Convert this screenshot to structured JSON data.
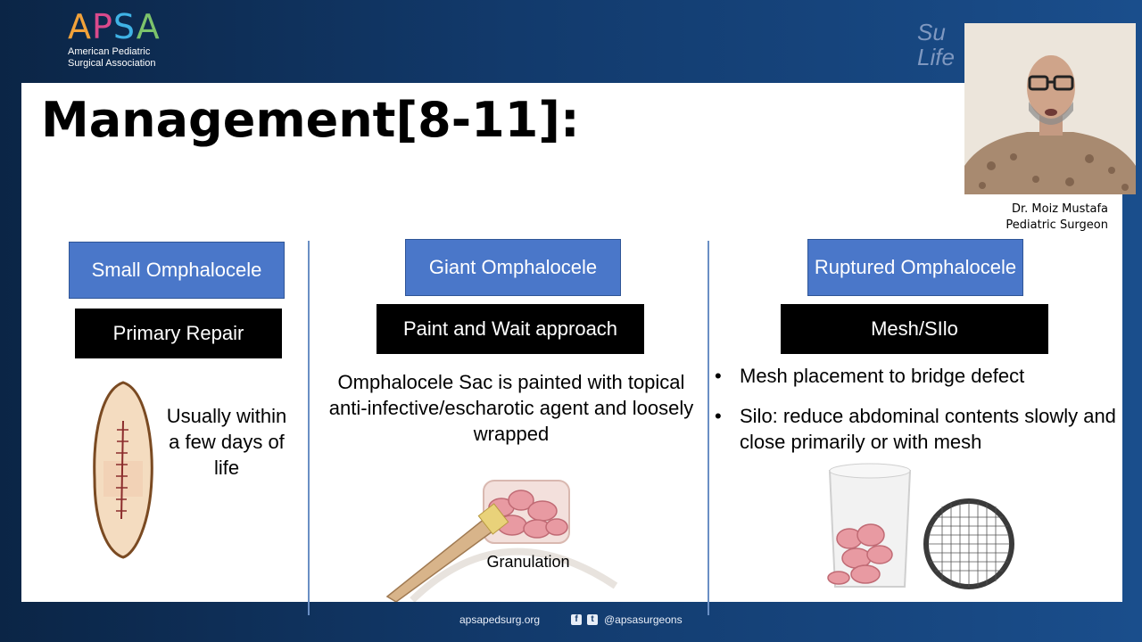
{
  "logo": {
    "letters": [
      "A",
      "P",
      "S",
      "A"
    ],
    "line1": "American Pediatric",
    "line2": "Surgical Association"
  },
  "corner_title": "Su   c\nLife",
  "slide": {
    "title": "Management[8-11]:",
    "columns": [
      {
        "header": "Small Omphalocele",
        "action": "Primary Repair",
        "note": "Usually within a few days of life"
      },
      {
        "header": "Giant Omphalocele",
        "action": "Paint and Wait approach",
        "note": "Omphalocele Sac is painted with topical anti-infective/escharotic agent and loosely wrapped",
        "figure_label": "Granulation"
      },
      {
        "header": "Ruptured Omphalocele",
        "action": "Mesh/SIlo",
        "bullets": [
          "Mesh placement to bridge defect",
          "Silo: reduce abdominal contents slowly and close primarily or with mesh"
        ]
      }
    ]
  },
  "speaker": {
    "name": "Dr. Moiz Mustafa",
    "role": "Pediatric Surgeon"
  },
  "footer": {
    "url": "apsapedsurg.org",
    "icons": [
      "facebook-icon",
      "twitter-icon"
    ],
    "handle": "@apsasurgeons"
  },
  "colors": {
    "background": "#123a6c",
    "header_box": "#4a77c9",
    "action_box": "#000000",
    "divider": "#6a8fc4"
  }
}
